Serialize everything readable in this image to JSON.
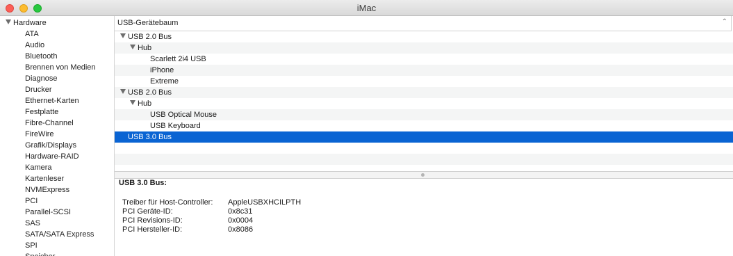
{
  "window": {
    "title": "iMac"
  },
  "sidebar": {
    "section_label": "Hardware",
    "items": [
      "ATA",
      "Audio",
      "Bluetooth",
      "Brennen von Medien",
      "Diagnose",
      "Drucker",
      "Ethernet-Karten",
      "Festplatte",
      "Fibre-Channel",
      "FireWire",
      "Grafik/Displays",
      "Hardware-RAID",
      "Kamera",
      "Kartenleser",
      "NVMExpress",
      "PCI",
      "Parallel-SCSI",
      "SAS",
      "SATA/SATA Express",
      "SPI",
      "Speicher"
    ]
  },
  "tree": {
    "column_header": "USB-Gerätebaum",
    "rows": [
      {
        "label": "USB 2.0 Bus",
        "level": 0,
        "expanded": true
      },
      {
        "label": "Hub",
        "level": 1,
        "expanded": true
      },
      {
        "label": "Scarlett 2i4 USB",
        "level": 2
      },
      {
        "label": "iPhone",
        "level": 2
      },
      {
        "label": "Extreme",
        "level": 2
      },
      {
        "label": "USB 2.0 Bus",
        "level": 0,
        "expanded": true
      },
      {
        "label": "Hub",
        "level": 1,
        "expanded": true
      },
      {
        "label": "USB Optical Mouse",
        "level": 2
      },
      {
        "label": "USB Keyboard",
        "level": 2
      },
      {
        "label": "USB 3.0 Bus",
        "level": 0,
        "selected": true
      }
    ]
  },
  "detail": {
    "title": "USB 3.0 Bus:",
    "fields": [
      {
        "key": "Treiber für Host-Controller:",
        "value": "AppleUSBXHCILPTH"
      },
      {
        "key": "PCI Geräte-ID:",
        "value": "0x8c31"
      },
      {
        "key": "PCI Revisions-ID:",
        "value": "0x0004"
      },
      {
        "key": "PCI Hersteller-ID:",
        "value": "0x8086"
      }
    ]
  },
  "colors": {
    "selection": "#0a64d3",
    "close": "#fc5f57",
    "minimize": "#fdbc2e",
    "zoom": "#28c840"
  }
}
